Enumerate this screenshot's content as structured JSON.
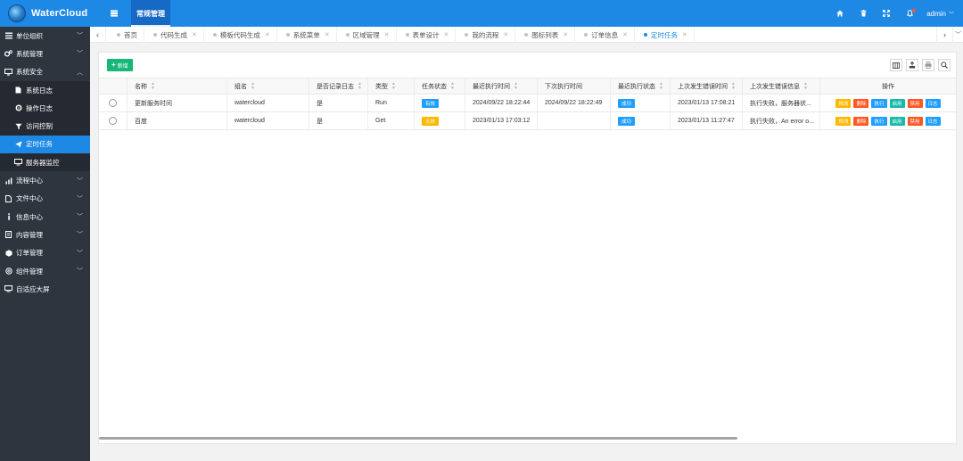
{
  "app": {
    "title": "WaterCloud"
  },
  "header": {
    "top_tab": "常规管理",
    "user": "admin"
  },
  "sidebar": {
    "items": [
      {
        "label": "单位组织",
        "icon": "bars-icon",
        "expanded": false
      },
      {
        "label": "系统管理",
        "icon": "gears-icon",
        "expanded": false
      },
      {
        "label": "系统安全",
        "icon": "desktop-icon",
        "expanded": true
      },
      {
        "label": "流程中心",
        "icon": "chart-icon",
        "expanded": false
      },
      {
        "label": "文件中心",
        "icon": "file-icon",
        "expanded": false
      },
      {
        "label": "信息中心",
        "icon": "info-icon",
        "expanded": false
      },
      {
        "label": "内容管理",
        "icon": "list-icon",
        "expanded": false
      },
      {
        "label": "订单管理",
        "icon": "cube-icon",
        "expanded": false
      },
      {
        "label": "组件管理",
        "icon": "snowflake-icon",
        "expanded": false
      },
      {
        "label": "自适应大屏",
        "icon": "monitor-icon",
        "expanded": false
      }
    ],
    "security_sub": [
      {
        "label": "系统日志",
        "icon": "file-icon"
      },
      {
        "label": "操作日志",
        "icon": "gear-icon"
      },
      {
        "label": "访问控制",
        "icon": "filter-icon"
      },
      {
        "label": "定时任务",
        "icon": "send-icon",
        "active": true
      },
      {
        "label": "服务器监控",
        "icon": "monitor-icon"
      }
    ]
  },
  "tabs": [
    {
      "label": "首页",
      "closable": false
    },
    {
      "label": "代码生成",
      "closable": true
    },
    {
      "label": "模板代码生成",
      "closable": true
    },
    {
      "label": "系统菜单",
      "closable": true
    },
    {
      "label": "区域管理",
      "closable": true
    },
    {
      "label": "表单设计",
      "closable": true
    },
    {
      "label": "我的流程",
      "closable": true
    },
    {
      "label": "图标列表",
      "closable": true
    },
    {
      "label": "订单信息",
      "closable": true
    },
    {
      "label": "定时任务",
      "closable": true,
      "active": true
    }
  ],
  "toolbar": {
    "add_label": "新增"
  },
  "table": {
    "headers": [
      "名称",
      "组名",
      "是否记录日志",
      "类型",
      "任务状态",
      "最近执行时间",
      "下次执行时间",
      "最近执行状态",
      "上次发生错误时间",
      "上次发生错误信息",
      "操作"
    ],
    "rows": [
      {
        "name": "更新服务时间",
        "group": "watercloud",
        "log": "是",
        "type": "Run",
        "status": "有效",
        "status_color": "#1e9fff",
        "last_run": "2024/09/22 18:22:44",
        "next_run": "2024/09/22 18:22:49",
        "last_status": "成功",
        "last_error_time": "2023/01/13 17:08:21",
        "last_error_msg": "执行失败，服务器状..."
      },
      {
        "name": "百度",
        "group": "watercloud",
        "log": "是",
        "type": "Get",
        "status": "无效",
        "status_color": "#ffb800",
        "last_run": "2023/01/13 17:03:12",
        "next_run": "",
        "last_status": "成功",
        "last_error_time": "2023/01/13 11:27:47",
        "last_error_msg": "执行失败，An error o..."
      }
    ],
    "actions": [
      {
        "label": "修改",
        "color": "#ffb800"
      },
      {
        "label": "删除",
        "color": "#ff5722"
      },
      {
        "label": "执行",
        "color": "#1e9fff"
      },
      {
        "label": "启用",
        "color": "#16baaa"
      },
      {
        "label": "禁用",
        "color": "#ff5722"
      },
      {
        "label": "日志",
        "color": "#1e9fff"
      }
    ]
  },
  "colors": {
    "brand": "#1e88e5",
    "sidebar": "#2f353f",
    "success": "#16b777"
  }
}
